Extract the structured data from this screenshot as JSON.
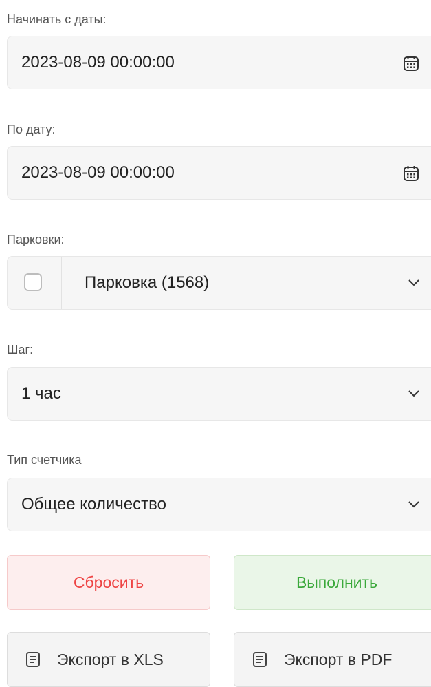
{
  "from_date": {
    "label": "Начинать с даты:",
    "value": "2023-08-09 00:00:00",
    "icon": "calendar-icon"
  },
  "to_date": {
    "label": "По дату:",
    "value": "2023-08-09 00:00:00",
    "icon": "calendar-icon"
  },
  "parkings": {
    "label": "Парковки:",
    "value": "Парковка (1568)",
    "checked": false
  },
  "step": {
    "label": "Шаг:",
    "value": "1 час"
  },
  "counter_type": {
    "label": "Тип счетчика",
    "value": "Общее количество"
  },
  "buttons": {
    "reset": "Сбросить",
    "run": "Выполнить",
    "export_xls": "Экспорт в XLS",
    "export_pdf": "Экспорт в PDF"
  },
  "colors": {
    "reset_text": "#ee4444",
    "reset_bg": "#fdeeee",
    "run_text": "#3aa83a",
    "run_bg": "#eaf6e8"
  }
}
